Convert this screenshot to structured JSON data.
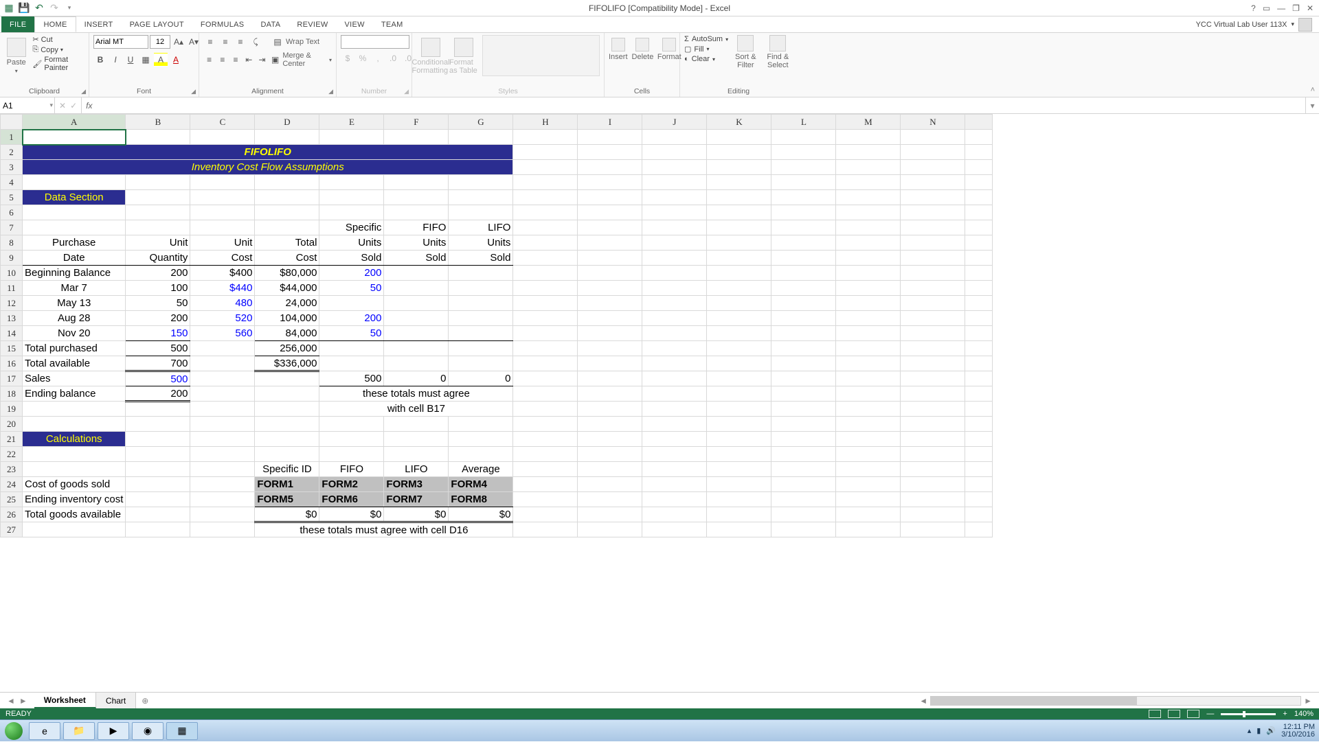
{
  "titlebar": {
    "title": "FIFOLIFO  [Compatibility Mode] - Excel"
  },
  "user": {
    "name": "YCC Virtual Lab User 113X"
  },
  "tabs": {
    "file": "FILE",
    "home": "HOME",
    "insert": "INSERT",
    "page": "PAGE LAYOUT",
    "formulas": "FORMULAS",
    "data": "DATA",
    "review": "REVIEW",
    "view": "VIEW",
    "team": "TEAM"
  },
  "ribbon": {
    "clipboard": {
      "paste": "Paste",
      "cut": "Cut",
      "copy": "Copy",
      "painter": "Format Painter",
      "label": "Clipboard"
    },
    "font": {
      "name": "Arial MT",
      "size": "12",
      "label": "Font"
    },
    "alignment": {
      "wrap": "Wrap Text",
      "merge": "Merge & Center",
      "label": "Alignment"
    },
    "number": {
      "label": "Number"
    },
    "styles": {
      "cond": "Conditional Formatting",
      "table": "Format as Table",
      "label": "Styles"
    },
    "cells": {
      "insert": "Insert",
      "delete": "Delete",
      "format": "Format",
      "label": "Cells"
    },
    "editing": {
      "sum": "AutoSum",
      "fill": "Fill",
      "clear": "Clear",
      "sort": "Sort & Filter",
      "find": "Find & Select",
      "label": "Editing"
    }
  },
  "namebox": "A1",
  "columns": [
    "A",
    "B",
    "C",
    "D",
    "E",
    "F",
    "G",
    "H",
    "I",
    "J",
    "K",
    "L",
    "M",
    "N"
  ],
  "sheet": {
    "title1": "FIFOLIFO",
    "title2": "Inventory Cost Flow Assumptions",
    "dataSection": "Data Section",
    "calcSection": "Calculations",
    "hdr": {
      "specific": "Specific",
      "fifo": "FIFO",
      "lifo": "LIFO",
      "purchase": "Purchase",
      "unit": "Unit",
      "total": "Total",
      "units": "Units",
      "date": "Date",
      "quantity": "Quantity",
      "cost": "Cost",
      "sold": "Sold"
    },
    "rows": [
      {
        "a": "Beginning Balance",
        "b": "200",
        "c": "$400",
        "d": "$80,000",
        "e": "200"
      },
      {
        "a": "Mar   7",
        "b": "100",
        "c": "$440",
        "d": "$44,000",
        "e": "50"
      },
      {
        "a": "May  13",
        "b": "50",
        "c": "480",
        "d": "24,000",
        "e": ""
      },
      {
        "a": "Aug  28",
        "b": "200",
        "c": "520",
        "d": "104,000",
        "e": "200"
      },
      {
        "a": "Nov  20",
        "b": "150",
        "c": "560",
        "d": "84,000",
        "e": "50"
      }
    ],
    "totPurchased": {
      "a": "Total purchased",
      "b": "500",
      "d": "256,000"
    },
    "totAvailable": {
      "a": "Total available",
      "b": "700",
      "d": "$336,000"
    },
    "sales": {
      "a": "Sales",
      "b": "500",
      "e": "500",
      "f": "0",
      "g": "0"
    },
    "ending": {
      "a": "Ending balance",
      "b": "200"
    },
    "note1": "these totals must agree",
    "note2": "with cell B17",
    "calcHdr": {
      "d": "Specific ID",
      "e": "FIFO",
      "f": "LIFO",
      "g": "Average"
    },
    "cogs": "Cost of goods sold",
    "eic": "Ending inventory cost",
    "tga": "Total goods available",
    "form": {
      "f1": "FORM1",
      "f2": "FORM2",
      "f3": "FORM3",
      "f4": "FORM4",
      "f5": "FORM5",
      "f6": "FORM6",
      "f7": "FORM7",
      "f8": "FORM8"
    },
    "zeros": "$0",
    "note3": "these totals must agree with cell D16"
  },
  "sheets": {
    "worksheet": "Worksheet",
    "chart": "Chart"
  },
  "status": {
    "ready": "READY",
    "zoom": "140%"
  },
  "taskbar": {
    "time": "12:11 PM",
    "date": "3/10/2016"
  }
}
